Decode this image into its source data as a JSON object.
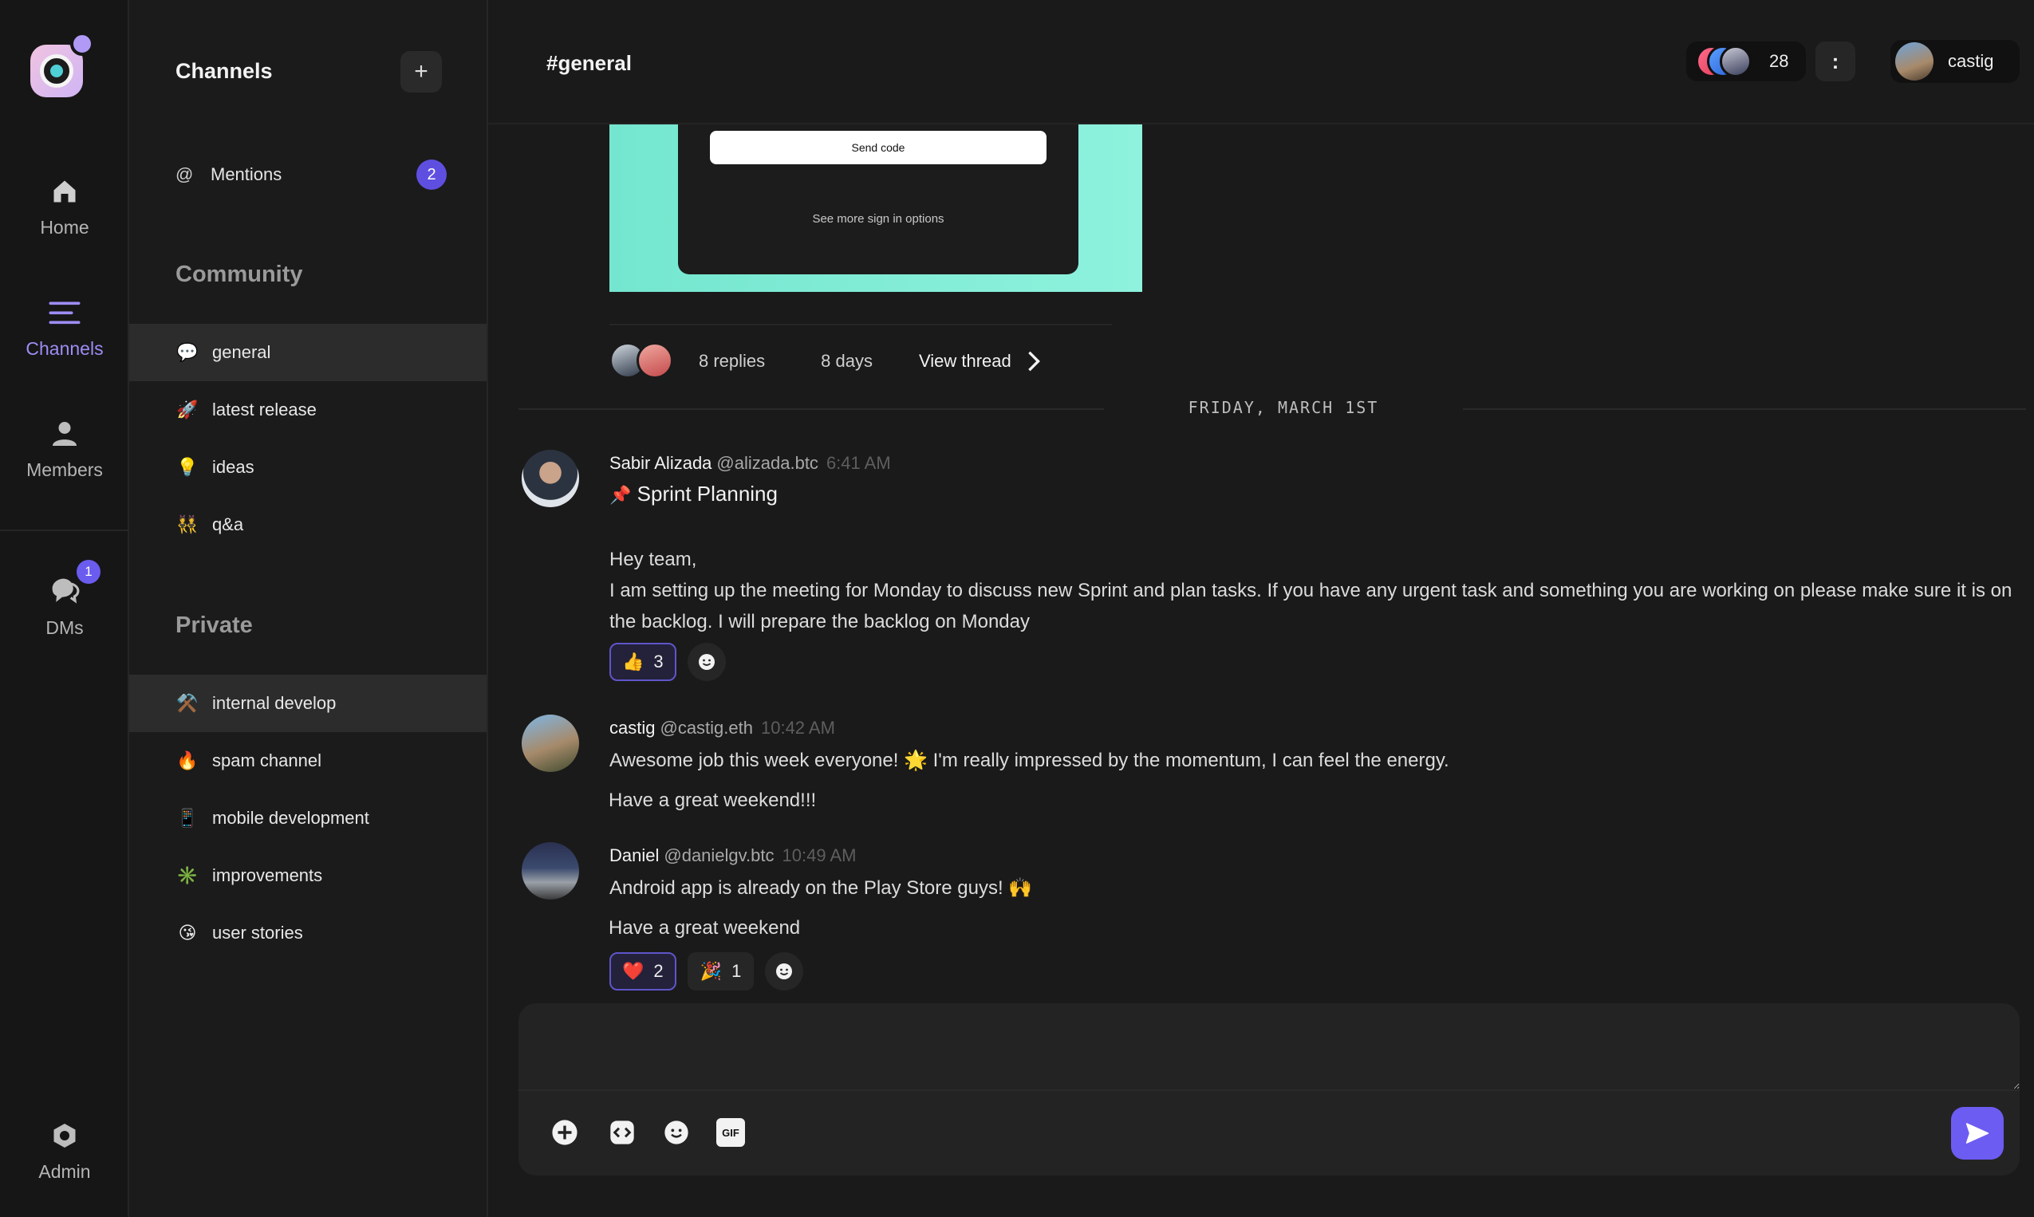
{
  "rail": {
    "items": [
      {
        "label": "Home",
        "icon": "home-icon"
      },
      {
        "label": "Channels",
        "icon": "channels-icon",
        "active": true
      },
      {
        "label": "Members",
        "icon": "members-icon"
      },
      {
        "label": "DMs",
        "icon": "dms-icon",
        "badge": "1"
      },
      {
        "label": "Admin",
        "icon": "admin-icon"
      }
    ]
  },
  "sidebar": {
    "title": "Channels",
    "add_label": "+",
    "mentions": {
      "label": "Mentions",
      "count": "2"
    },
    "sections": [
      {
        "title": "Community",
        "channels": [
          {
            "emoji": "💬",
            "name": "general",
            "active": true
          },
          {
            "emoji": "🚀",
            "name": "latest release"
          },
          {
            "emoji": "💡",
            "name": "ideas"
          },
          {
            "emoji": "👯",
            "name": "q&a"
          }
        ]
      },
      {
        "title": "Private",
        "channels": [
          {
            "emoji": "⚒️",
            "name": "internal develop",
            "active": true
          },
          {
            "emoji": "🔥",
            "name": "spam channel"
          },
          {
            "emoji": "📱",
            "name": "mobile development"
          },
          {
            "emoji": "✳️",
            "name": "improvements"
          },
          {
            "emoji": "😘",
            "name": "user stories"
          }
        ]
      }
    ]
  },
  "header": {
    "channel_title": "#general",
    "member_count": "28",
    "more_label": ":",
    "user_name": "castig"
  },
  "attachment": {
    "button_label": "Send code",
    "link_label": "See more sign in options"
  },
  "thread": {
    "replies": "8 replies",
    "age": "8 days",
    "view_label": "View thread"
  },
  "date_divider": "FRIDAY, MARCH 1ST",
  "messages": [
    {
      "author": "Sabir Alizada",
      "handle": "@alizada.btc",
      "time": "6:41 AM",
      "title_emoji": "📌",
      "title": "Sprint Planning",
      "lines": [
        "Hey team,",
        "I am setting up the meeting for Monday to discuss new Sprint and plan tasks. If you have any urgent task and something you are working on please make sure it is on the backlog. I will prepare the backlog on Monday"
      ],
      "reactions": [
        {
          "emoji": "👍",
          "count": "3",
          "mine": true
        }
      ]
    },
    {
      "author": "castig",
      "handle": "@castig.eth",
      "time": "10:42 AM",
      "lines": [
        "Awesome job this week everyone! 🌟 I'm really impressed by the momentum, I can feel the energy.",
        "Have a great weekend!!!"
      ]
    },
    {
      "author": "Daniel",
      "handle": "@danielgv.btc",
      "time": "10:49 AM",
      "lines": [
        "Android app is already on the Play Store guys! 🙌",
        "Have a great weekend"
      ],
      "reactions": [
        {
          "emoji": "❤️",
          "count": "2",
          "mine": true
        },
        {
          "emoji": "🎉",
          "count": "1",
          "mine": false
        }
      ]
    }
  ],
  "composer": {
    "placeholder": "",
    "gif_label": "GIF"
  },
  "colors": {
    "accent": "#6d5cf2",
    "badge": "#5f4fe0",
    "active_nav": "#9d8df5"
  }
}
